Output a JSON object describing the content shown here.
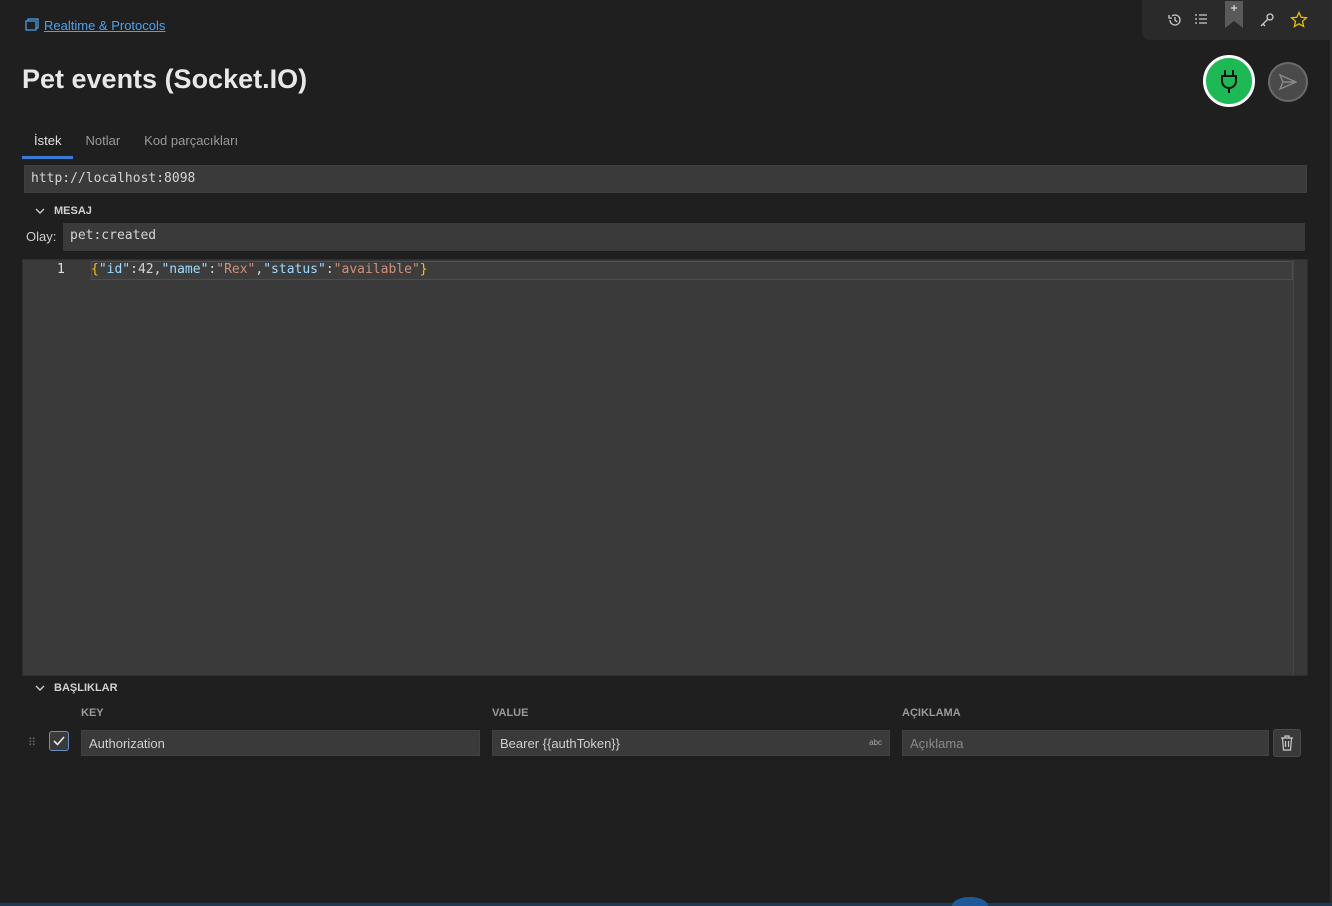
{
  "breadcrumb": {
    "label": "Realtime & Protocols"
  },
  "page": {
    "title": "Pet events (Socket.IO)"
  },
  "tabs": [
    {
      "label": "İstek",
      "active": true
    },
    {
      "label": "Notlar",
      "active": false
    },
    {
      "label": "Kod parçacıkları",
      "active": false
    }
  ],
  "url": {
    "value": "http://localhost:8098"
  },
  "message": {
    "section_label": "MESAJ",
    "event_label": "Olay:",
    "event_value": "pet:created",
    "line_number": "1",
    "body": {
      "open_brace": "{",
      "k1": "\"id\"",
      "colon1": ":",
      "v1": "42",
      "comma1": ",",
      "k2": "\"name\"",
      "colon2": ":",
      "v2": "\"Rex\"",
      "comma2": ",",
      "k3": "\"status\"",
      "colon3": ":",
      "v3": "\"available\"",
      "close_brace": "}"
    }
  },
  "headers": {
    "section_label": "BAŞLIKLAR",
    "columns": {
      "key": "KEY",
      "value": "VALUE",
      "description": "AÇIKLAMA"
    },
    "rows": [
      {
        "enabled": true,
        "key": "Authorization",
        "value": "Bearer {{authToken}}",
        "value_type_badge": "abc",
        "description_placeholder": "Açıklama"
      }
    ]
  },
  "colors": {
    "background": "#1f1f1f",
    "accent": "#3a7bd5",
    "connect": "#1db954",
    "link": "#4aa3f0"
  },
  "icons": {
    "breadcrumb": "collection-icon",
    "toolbar": [
      "history-icon",
      "list-icon",
      "bookmark-plus-icon",
      "key-icon",
      "star-icon"
    ],
    "connect": "plug-icon",
    "send": "send-icon",
    "collapse": "chevron-down-icon",
    "checkbox": "check-icon",
    "delete": "trash-icon",
    "drag": "drag-handle-icon"
  }
}
